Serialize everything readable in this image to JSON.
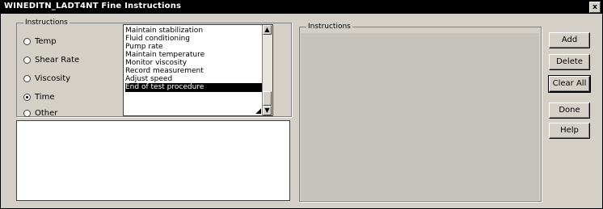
{
  "window": {
    "title": "WINEDITN_LADT4NT Fine Instructions",
    "close_label": "x"
  },
  "left_group": {
    "legend": "Instructions",
    "radios": [
      {
        "label": "Temp",
        "selected": false
      },
      {
        "label": "Shear Rate",
        "selected": false
      },
      {
        "label": "Viscosity",
        "selected": false
      },
      {
        "label": "Time",
        "selected": true
      },
      {
        "label": "Other",
        "selected": false
      }
    ]
  },
  "listbox": {
    "items": [
      "Maintain stabilization",
      "Fluid conditioning",
      "Pump rate",
      "Maintain temperature",
      "Monitor viscosity",
      "Record measurement",
      "Adjust speed",
      "End of test procedure"
    ],
    "selected_index": 7,
    "scroll_up": "▲",
    "scroll_down": "▼",
    "resize_icon": "◢"
  },
  "right_group": {
    "legend": "Instructions"
  },
  "buttons": [
    {
      "label": "Add"
    },
    {
      "label": "Delete"
    },
    {
      "label": "Clear All"
    },
    {
      "label": "Done"
    },
    {
      "label": "Help"
    }
  ]
}
